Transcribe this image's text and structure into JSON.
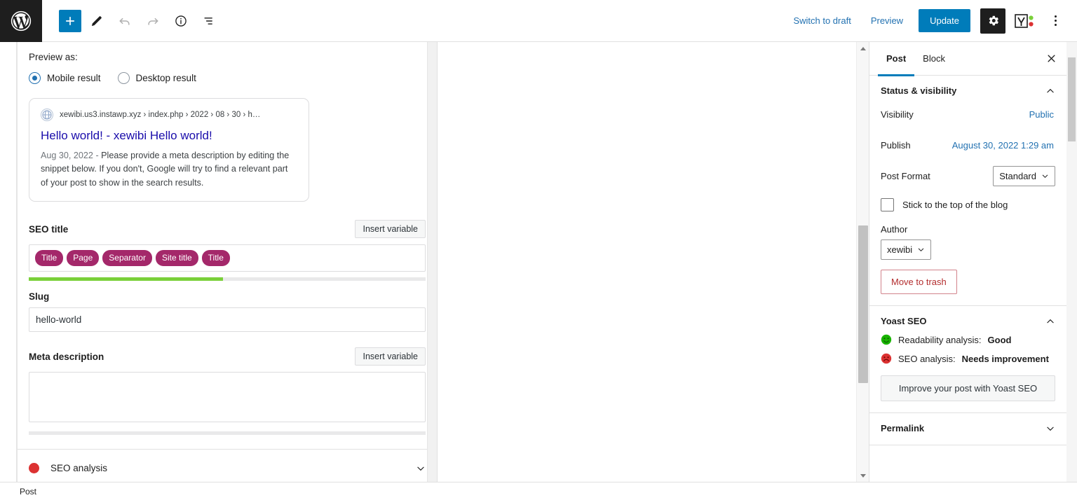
{
  "topbar": {
    "logo_icon": "wordpress-logo-icon",
    "add_block_icon": "plus-icon",
    "edit_icon": "pencil-icon",
    "undo_icon": "undo-arrow-icon",
    "redo_icon": "redo-arrow-icon",
    "info_icon": "info-circle-icon",
    "list_view_icon": "list-view-icon",
    "switch_to_draft": "Switch to draft",
    "preview": "Preview",
    "update": "Update",
    "settings_icon": "gear-icon",
    "yoast_icon": "yoast-seo-icon",
    "options_icon": "kebab-menu-icon",
    "accent": "#007cba",
    "link_color": "#2271b1"
  },
  "seo_panel": {
    "preview_as_label": "Preview as:",
    "preview_options": [
      {
        "label": "Mobile result",
        "selected": true
      },
      {
        "label": "Desktop result",
        "selected": false
      }
    ],
    "snippet": {
      "favicon_icon": "globe-icon",
      "url": "xewibi.us3.instawp.xyz › index.php › 2022 › 08 › 30 › h…",
      "title": "Hello world! - xewibi Hello world!",
      "date": "Aug 30, 2022",
      "separator": "-",
      "description": "Please provide a meta description by editing the snippet below. If you don't, Google will try to find a relevant part of your post to show in the search results."
    },
    "seo_title": {
      "label": "SEO title",
      "insert_variable": "Insert variable",
      "pills": [
        "Title",
        "Page",
        "Separator",
        "Site title",
        "Title"
      ],
      "progress_percent": 49,
      "progress_color": "#7ad03a",
      "progress_track": "#e9e9ea"
    },
    "slug": {
      "label": "Slug",
      "value": "hello-world"
    },
    "meta_description": {
      "label": "Meta description",
      "insert_variable": "Insert variable",
      "value": "",
      "placeholder": "",
      "progress_percent": 0,
      "progress_color": "#e9e9ea"
    },
    "seo_analysis": {
      "label": "SEO analysis",
      "bullet_color": "#dc3232",
      "chevron_icon": "chevron-down-icon"
    }
  },
  "sidebar": {
    "tabs": [
      {
        "label": "Post",
        "active": true
      },
      {
        "label": "Block",
        "active": false
      }
    ],
    "close_icon": "close-icon",
    "status_visibility": {
      "title": "Status & visibility",
      "chevron_icon": "chevron-up-icon",
      "visibility_label": "Visibility",
      "visibility_value": "Public",
      "publish_label": "Publish",
      "publish_value": "August 30, 2022 1:29 am",
      "post_format_label": "Post Format",
      "post_format_value": "Standard",
      "post_format_chevron": "chevron-down-icon",
      "sticky_label": "Stick to the top of the blog",
      "sticky_checked": false,
      "author_label": "Author",
      "author_value": "xewibi",
      "author_chevron": "chevron-down-icon",
      "trash_label": "Move to trash",
      "trash_color": "#b32d2e"
    },
    "yoast": {
      "title": "Yoast SEO",
      "chevron_icon": "chevron-up-icon",
      "rows": [
        {
          "icon": "smiley-good-icon",
          "label": "Readability analysis:",
          "value": "Good",
          "color": "#7ad03a"
        },
        {
          "icon": "smiley-bad-icon",
          "label": "SEO analysis:",
          "value": "Needs improvement",
          "color": "#dc3232"
        }
      ],
      "improve_button": "Improve your post with Yoast SEO"
    },
    "permalink": {
      "title": "Permalink",
      "chevron_icon": "chevron-down-icon"
    }
  },
  "bottombar": {
    "breadcrumb": "Post"
  }
}
